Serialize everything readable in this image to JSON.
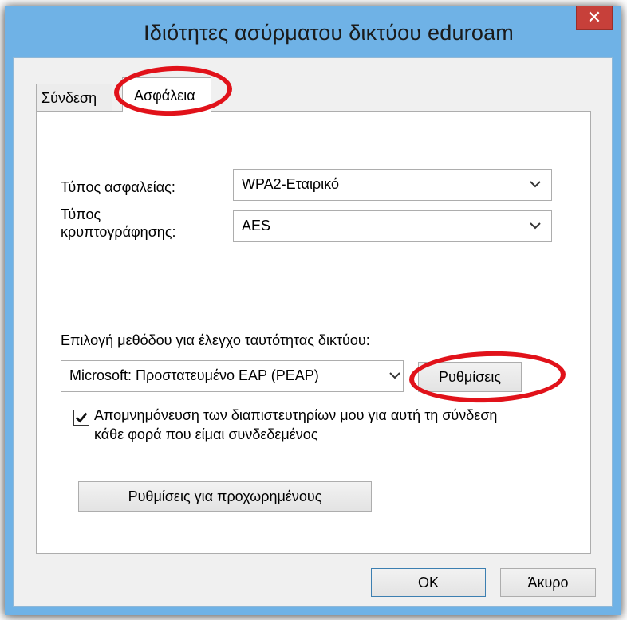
{
  "window": {
    "title": "Ιδιότητες ασύρματου δικτύου eduroam",
    "close_glyph": "✕"
  },
  "tabs": [
    {
      "label": "Σύνδεση",
      "selected": false
    },
    {
      "label": "Ασφάλεια",
      "selected": true
    }
  ],
  "security": {
    "security_type_label": "Τύπος ασφαλείας:",
    "security_type_value": "WPA2-Εταιρικό",
    "encryption_type_label_line1": "Τύπος",
    "encryption_type_label_line2": "κρυπτογράφησης:",
    "encryption_type_value": "AES",
    "auth_method_label": "Επιλογή μεθόδου για έλεγχο ταυτότητας δικτύου:",
    "auth_method_value": "Microsoft: Προστατευμένο EAP (PEAP)",
    "settings_button": "Ρυθμίσεις",
    "remember_checkbox_checked": true,
    "remember_line1": "Απομνημόνευση των διαπιστευτηρίων μου για αυτή τη σύνδεση",
    "remember_line2": "κάθε φορά που είμαι συνδεδεμένος",
    "advanced_button": "Ρυθμίσεις για προχωρημένους"
  },
  "footer": {
    "ok_button": "OK",
    "cancel_button": "Άκυρο"
  },
  "colors": {
    "window_frame": "#6fb2e6",
    "close_button": "#c7403a",
    "highlight": "#e1121a"
  }
}
